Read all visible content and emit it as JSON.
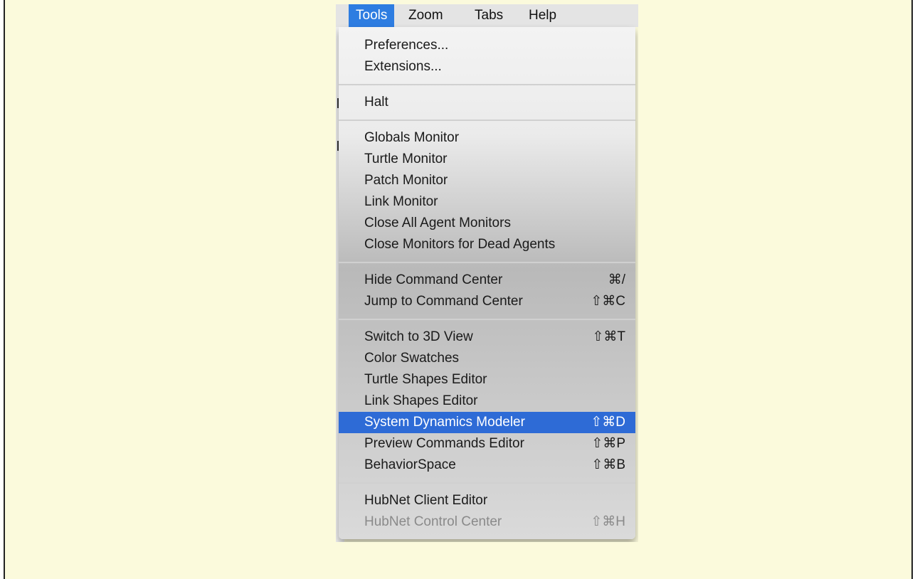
{
  "menubar": {
    "items": [
      {
        "label": "Tools"
      },
      {
        "label": "Zoom"
      },
      {
        "label": "Tabs"
      },
      {
        "label": "Help"
      }
    ]
  },
  "menu": {
    "items": [
      {
        "label": "Preferences...",
        "shortcut": ""
      },
      {
        "label": "Extensions...",
        "shortcut": ""
      },
      {
        "label": "Halt",
        "shortcut": ""
      },
      {
        "label": "Globals Monitor",
        "shortcut": ""
      },
      {
        "label": "Turtle Monitor",
        "shortcut": ""
      },
      {
        "label": "Patch Monitor",
        "shortcut": ""
      },
      {
        "label": "Link Monitor",
        "shortcut": ""
      },
      {
        "label": "Close All Agent Monitors",
        "shortcut": ""
      },
      {
        "label": "Close Monitors for Dead Agents",
        "shortcut": ""
      },
      {
        "label": "Hide Command Center",
        "shortcut": "⌘/"
      },
      {
        "label": "Jump to Command Center",
        "shortcut": "⇧⌘C"
      },
      {
        "label": "Switch to 3D View",
        "shortcut": "⇧⌘T"
      },
      {
        "label": "Color Swatches",
        "shortcut": ""
      },
      {
        "label": "Turtle Shapes Editor",
        "shortcut": ""
      },
      {
        "label": "Link Shapes Editor",
        "shortcut": ""
      },
      {
        "label": "System Dynamics Modeler",
        "shortcut": "⇧⌘D"
      },
      {
        "label": "Preview Commands Editor",
        "shortcut": "⇧⌘P"
      },
      {
        "label": "BehaviorSpace",
        "shortcut": "⇧⌘B"
      },
      {
        "label": "HubNet Client Editor",
        "shortcut": ""
      },
      {
        "label": "HubNet Control Center",
        "shortcut": "⇧⌘H"
      }
    ]
  },
  "colors": {
    "background": "#fbfadc",
    "highlight": "#2e6bd6",
    "menubar_active": "#2e7de1"
  }
}
